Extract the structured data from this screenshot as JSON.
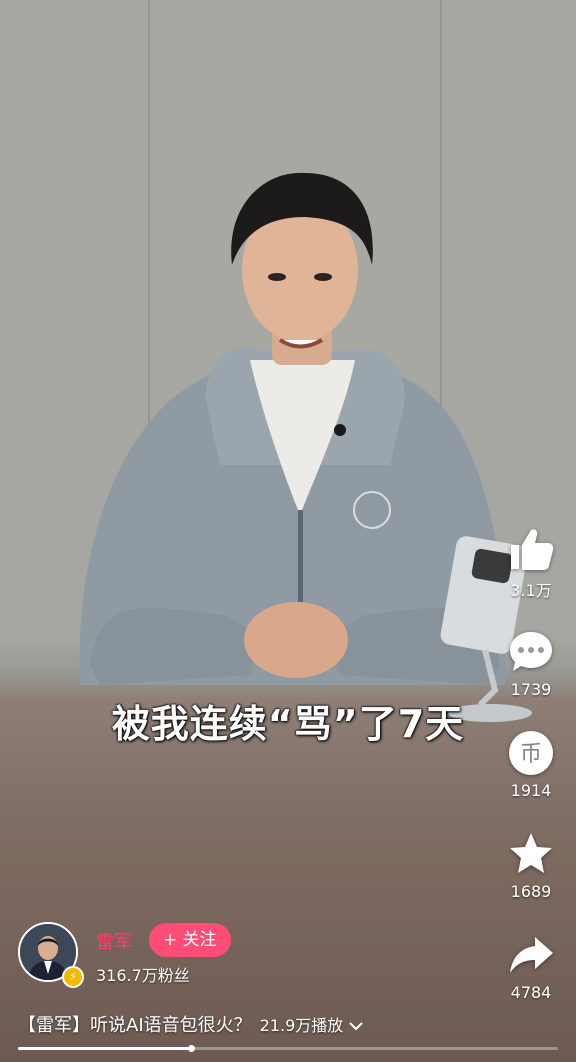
{
  "video": {
    "subtitle": "被我连续“骂”了7天",
    "progress": 0.32
  },
  "actions": {
    "like": {
      "icon": "thumbs-up-icon",
      "count": "3.1万"
    },
    "comment": {
      "icon": "comment-bubble-icon",
      "count": "1739"
    },
    "coin": {
      "icon": "coin-icon",
      "glyph": "币",
      "count": "1914"
    },
    "favorite": {
      "icon": "star-icon",
      "count": "1689"
    },
    "share": {
      "icon": "share-arrow-icon",
      "count": "4784"
    }
  },
  "author": {
    "name": "雷军",
    "follow_label": "+ 关注",
    "fans": "316.7万粉丝",
    "badge": "⚡"
  },
  "caption": {
    "title": "【雷军】听说AI语音包很火？",
    "plays": "21.9万播放",
    "expand_icon": "chevron-down-icon"
  },
  "colors": {
    "accent": "#ff4d78",
    "author_name": "#ff3d6e"
  }
}
